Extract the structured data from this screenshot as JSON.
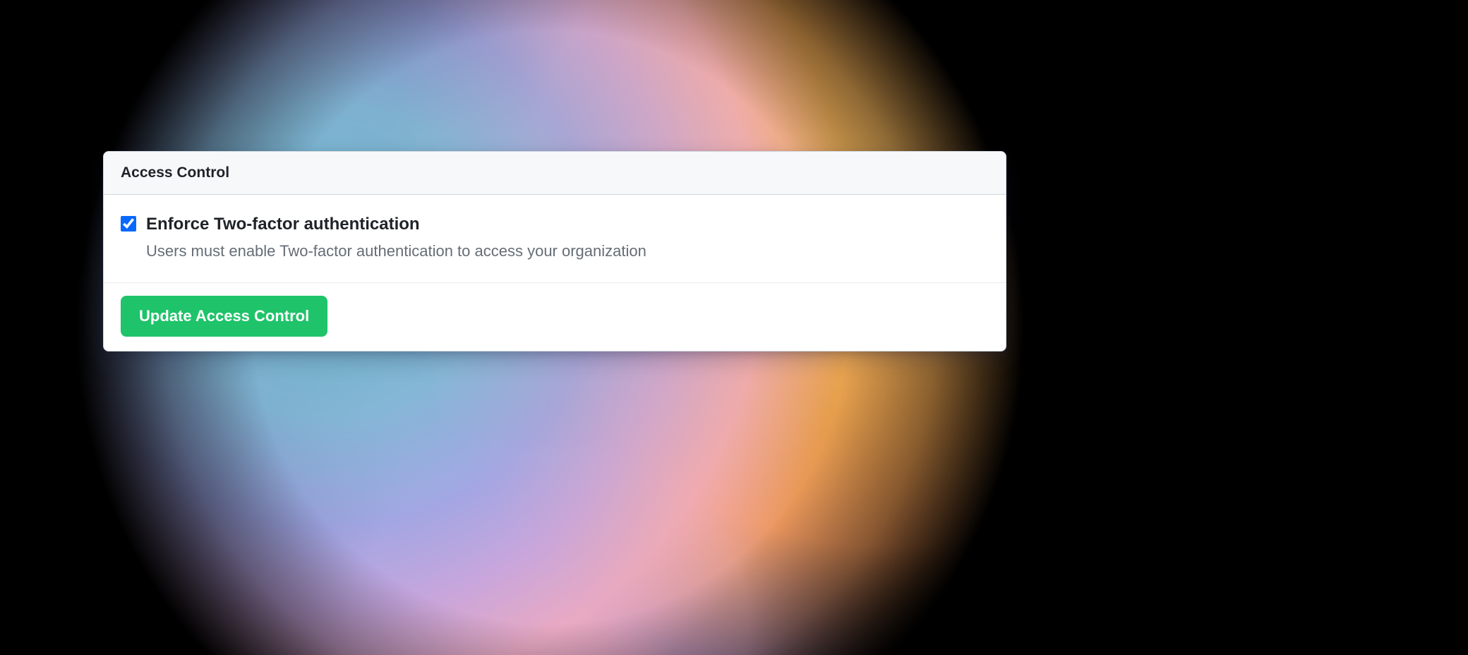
{
  "panel": {
    "title": "Access Control",
    "option": {
      "checked": true,
      "label": "Enforce Two-factor authentication",
      "description": "Users must enable Two-factor authentication to access your organization"
    },
    "submit_label": "Update Access Control"
  },
  "colors": {
    "accent_button": "#1fc36a",
    "checkbox_accent": "#0969ff",
    "text_primary": "#1f2328",
    "text_muted": "#656d76",
    "border": "#d0d7de",
    "header_bg": "#f6f8fa"
  }
}
